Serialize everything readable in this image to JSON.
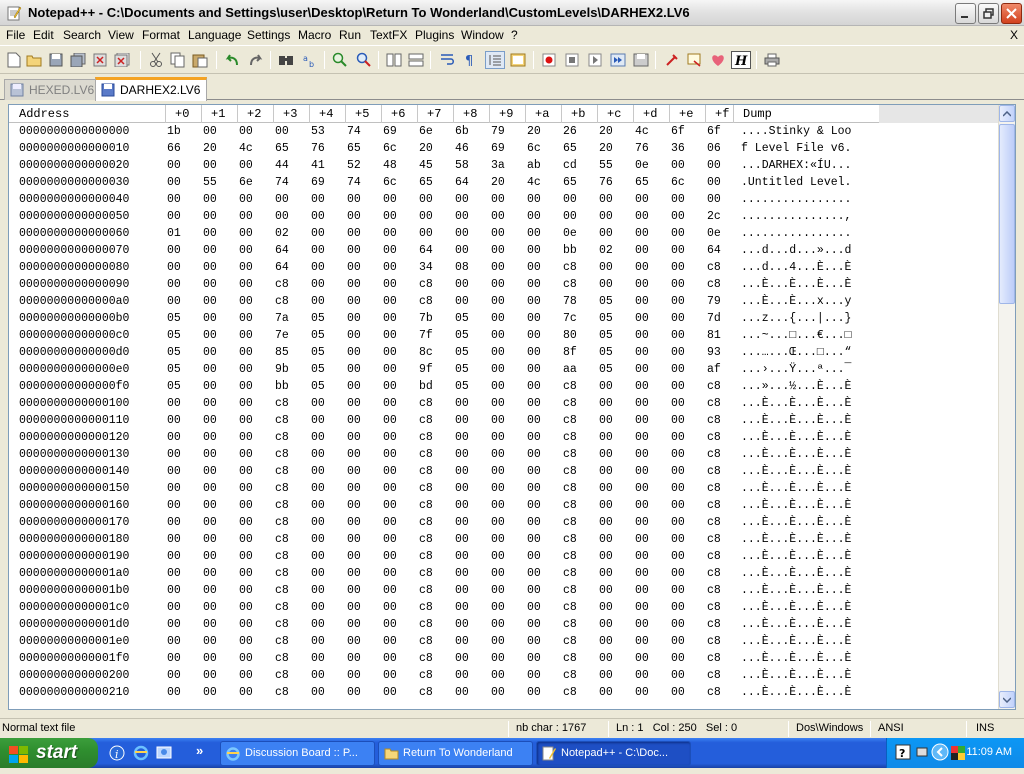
{
  "window": {
    "title": "Notepad++ - C:\\Documents and Settings\\user\\Desktop\\Return To Wonderland\\CustomLevels\\DARHEX2.LV6"
  },
  "menu": [
    "File",
    "Edit",
    "Search",
    "View",
    "Format",
    "Language",
    "Settings",
    "Macro",
    "Run",
    "TextFX",
    "Plugins",
    "Window",
    "?"
  ],
  "menu_close": "X",
  "tabs": [
    {
      "label": "HEXED.LV6",
      "active": false
    },
    {
      "label": "DARHEX2.LV6",
      "active": true
    }
  ],
  "hex": {
    "headers": [
      "Address",
      "+0",
      "+1",
      "+2",
      "+3",
      "+4",
      "+5",
      "+6",
      "+7",
      "+8",
      "+9",
      "+a",
      "+b",
      "+c",
      "+d",
      "+e",
      "+f",
      "Dump"
    ],
    "rows": [
      [
        "0000000000000000",
        "1b",
        "00",
        "00",
        "00",
        "53",
        "74",
        "69",
        "6e",
        "6b",
        "79",
        "20",
        "26",
        "20",
        "4c",
        "6f",
        "6f",
        "....Stinky & Loo"
      ],
      [
        "0000000000000010",
        "66",
        "20",
        "4c",
        "65",
        "76",
        "65",
        "6c",
        "20",
        "46",
        "69",
        "6c",
        "65",
        "20",
        "76",
        "36",
        "06",
        "f Level File v6."
      ],
      [
        "0000000000000020",
        "00",
        "00",
        "00",
        "44",
        "41",
        "52",
        "48",
        "45",
        "58",
        "3a",
        "ab",
        "cd",
        "55",
        "0e",
        "00",
        "00",
        "...DARHEX:«ÍU..."
      ],
      [
        "0000000000000030",
        "00",
        "55",
        "6e",
        "74",
        "69",
        "74",
        "6c",
        "65",
        "64",
        "20",
        "4c",
        "65",
        "76",
        "65",
        "6c",
        "00",
        ".Untitled Level."
      ],
      [
        "0000000000000040",
        "00",
        "00",
        "00",
        "00",
        "00",
        "00",
        "00",
        "00",
        "00",
        "00",
        "00",
        "00",
        "00",
        "00",
        "00",
        "00",
        "................"
      ],
      [
        "0000000000000050",
        "00",
        "00",
        "00",
        "00",
        "00",
        "00",
        "00",
        "00",
        "00",
        "00",
        "00",
        "00",
        "00",
        "00",
        "00",
        "2c",
        "...............,"
      ],
      [
        "0000000000000060",
        "01",
        "00",
        "00",
        "02",
        "00",
        "00",
        "00",
        "00",
        "00",
        "00",
        "00",
        "0e",
        "00",
        "00",
        "00",
        "0e",
        "................"
      ],
      [
        "0000000000000070",
        "00",
        "00",
        "00",
        "64",
        "00",
        "00",
        "00",
        "64",
        "00",
        "00",
        "00",
        "bb",
        "02",
        "00",
        "00",
        "64",
        "...d...d...»...d"
      ],
      [
        "0000000000000080",
        "00",
        "00",
        "00",
        "64",
        "00",
        "00",
        "00",
        "34",
        "08",
        "00",
        "00",
        "c8",
        "00",
        "00",
        "00",
        "c8",
        "...d...4...È...È"
      ],
      [
        "0000000000000090",
        "00",
        "00",
        "00",
        "c8",
        "00",
        "00",
        "00",
        "c8",
        "00",
        "00",
        "00",
        "c8",
        "00",
        "00",
        "00",
        "c8",
        "...È...È...È...È"
      ],
      [
        "00000000000000a0",
        "00",
        "00",
        "00",
        "c8",
        "00",
        "00",
        "00",
        "c8",
        "00",
        "00",
        "00",
        "78",
        "05",
        "00",
        "00",
        "79",
        "...È...È...x...y"
      ],
      [
        "00000000000000b0",
        "05",
        "00",
        "00",
        "7a",
        "05",
        "00",
        "00",
        "7b",
        "05",
        "00",
        "00",
        "7c",
        "05",
        "00",
        "00",
        "7d",
        "...z...{...|...}"
      ],
      [
        "00000000000000c0",
        "05",
        "00",
        "00",
        "7e",
        "05",
        "00",
        "00",
        "7f",
        "05",
        "00",
        "00",
        "80",
        "05",
        "00",
        "00",
        "81",
        "...~...□...€...□"
      ],
      [
        "00000000000000d0",
        "05",
        "00",
        "00",
        "85",
        "05",
        "00",
        "00",
        "8c",
        "05",
        "00",
        "00",
        "8f",
        "05",
        "00",
        "00",
        "93",
        "...…...Œ...□...“"
      ],
      [
        "00000000000000e0",
        "05",
        "00",
        "00",
        "9b",
        "05",
        "00",
        "00",
        "9f",
        "05",
        "00",
        "00",
        "aa",
        "05",
        "00",
        "00",
        "af",
        "...›...Ÿ...ª...¯"
      ],
      [
        "00000000000000f0",
        "05",
        "00",
        "00",
        "bb",
        "05",
        "00",
        "00",
        "bd",
        "05",
        "00",
        "00",
        "c8",
        "00",
        "00",
        "00",
        "c8",
        "...»...½...È...È"
      ],
      [
        "0000000000000100",
        "00",
        "00",
        "00",
        "c8",
        "00",
        "00",
        "00",
        "c8",
        "00",
        "00",
        "00",
        "c8",
        "00",
        "00",
        "00",
        "c8",
        "...È...È...È...È"
      ],
      [
        "0000000000000110",
        "00",
        "00",
        "00",
        "c8",
        "00",
        "00",
        "00",
        "c8",
        "00",
        "00",
        "00",
        "c8",
        "00",
        "00",
        "00",
        "c8",
        "...È...È...È...È"
      ],
      [
        "0000000000000120",
        "00",
        "00",
        "00",
        "c8",
        "00",
        "00",
        "00",
        "c8",
        "00",
        "00",
        "00",
        "c8",
        "00",
        "00",
        "00",
        "c8",
        "...È...È...È...È"
      ],
      [
        "0000000000000130",
        "00",
        "00",
        "00",
        "c8",
        "00",
        "00",
        "00",
        "c8",
        "00",
        "00",
        "00",
        "c8",
        "00",
        "00",
        "00",
        "c8",
        "...È...È...È...È"
      ],
      [
        "0000000000000140",
        "00",
        "00",
        "00",
        "c8",
        "00",
        "00",
        "00",
        "c8",
        "00",
        "00",
        "00",
        "c8",
        "00",
        "00",
        "00",
        "c8",
        "...È...È...È...È"
      ],
      [
        "0000000000000150",
        "00",
        "00",
        "00",
        "c8",
        "00",
        "00",
        "00",
        "c8",
        "00",
        "00",
        "00",
        "c8",
        "00",
        "00",
        "00",
        "c8",
        "...È...È...È...È"
      ],
      [
        "0000000000000160",
        "00",
        "00",
        "00",
        "c8",
        "00",
        "00",
        "00",
        "c8",
        "00",
        "00",
        "00",
        "c8",
        "00",
        "00",
        "00",
        "c8",
        "...È...È...È...È"
      ],
      [
        "0000000000000170",
        "00",
        "00",
        "00",
        "c8",
        "00",
        "00",
        "00",
        "c8",
        "00",
        "00",
        "00",
        "c8",
        "00",
        "00",
        "00",
        "c8",
        "...È...È...È...È"
      ],
      [
        "0000000000000180",
        "00",
        "00",
        "00",
        "c8",
        "00",
        "00",
        "00",
        "c8",
        "00",
        "00",
        "00",
        "c8",
        "00",
        "00",
        "00",
        "c8",
        "...È...È...È...È"
      ],
      [
        "0000000000000190",
        "00",
        "00",
        "00",
        "c8",
        "00",
        "00",
        "00",
        "c8",
        "00",
        "00",
        "00",
        "c8",
        "00",
        "00",
        "00",
        "c8",
        "...È...È...È...È"
      ],
      [
        "00000000000001a0",
        "00",
        "00",
        "00",
        "c8",
        "00",
        "00",
        "00",
        "c8",
        "00",
        "00",
        "00",
        "c8",
        "00",
        "00",
        "00",
        "c8",
        "...È...È...È...È"
      ],
      [
        "00000000000001b0",
        "00",
        "00",
        "00",
        "c8",
        "00",
        "00",
        "00",
        "c8",
        "00",
        "00",
        "00",
        "c8",
        "00",
        "00",
        "00",
        "c8",
        "...È...È...È...È"
      ],
      [
        "00000000000001c0",
        "00",
        "00",
        "00",
        "c8",
        "00",
        "00",
        "00",
        "c8",
        "00",
        "00",
        "00",
        "c8",
        "00",
        "00",
        "00",
        "c8",
        "...È...È...È...È"
      ],
      [
        "00000000000001d0",
        "00",
        "00",
        "00",
        "c8",
        "00",
        "00",
        "00",
        "c8",
        "00",
        "00",
        "00",
        "c8",
        "00",
        "00",
        "00",
        "c8",
        "...È...È...È...È"
      ],
      [
        "00000000000001e0",
        "00",
        "00",
        "00",
        "c8",
        "00",
        "00",
        "00",
        "c8",
        "00",
        "00",
        "00",
        "c8",
        "00",
        "00",
        "00",
        "c8",
        "...È...È...È...È"
      ],
      [
        "00000000000001f0",
        "00",
        "00",
        "00",
        "c8",
        "00",
        "00",
        "00",
        "c8",
        "00",
        "00",
        "00",
        "c8",
        "00",
        "00",
        "00",
        "c8",
        "...È...È...È...È"
      ],
      [
        "0000000000000200",
        "00",
        "00",
        "00",
        "c8",
        "00",
        "00",
        "00",
        "c8",
        "00",
        "00",
        "00",
        "c8",
        "00",
        "00",
        "00",
        "c8",
        "...È...È...È...È"
      ],
      [
        "0000000000000210",
        "00",
        "00",
        "00",
        "c8",
        "00",
        "00",
        "00",
        "c8",
        "00",
        "00",
        "00",
        "c8",
        "00",
        "00",
        "00",
        "c8",
        "...È...È...È...È"
      ]
    ]
  },
  "status": {
    "type": "Normal text file",
    "chars": "nb char : 1767",
    "position": "Ln : 1   Col : 250   Sel : 0",
    "eol": "Dos\\Windows",
    "encoding": "ANSI",
    "mode": "INS"
  },
  "taskbar": {
    "start": "start",
    "tasks": [
      {
        "label": "Discussion Board :: P...",
        "active": false,
        "icon": "ie-icon"
      },
      {
        "label": "Return To Wonderland",
        "active": false,
        "icon": "folder-icon"
      },
      {
        "label": "Notepad++ - C:\\Doc...",
        "active": true,
        "icon": "notepad-icon"
      }
    ],
    "clock": "11:09 AM"
  },
  "colors": {
    "taskbar": "#245edb",
    "start": "#2f8f2f",
    "tab_accent": "#f4a323"
  }
}
